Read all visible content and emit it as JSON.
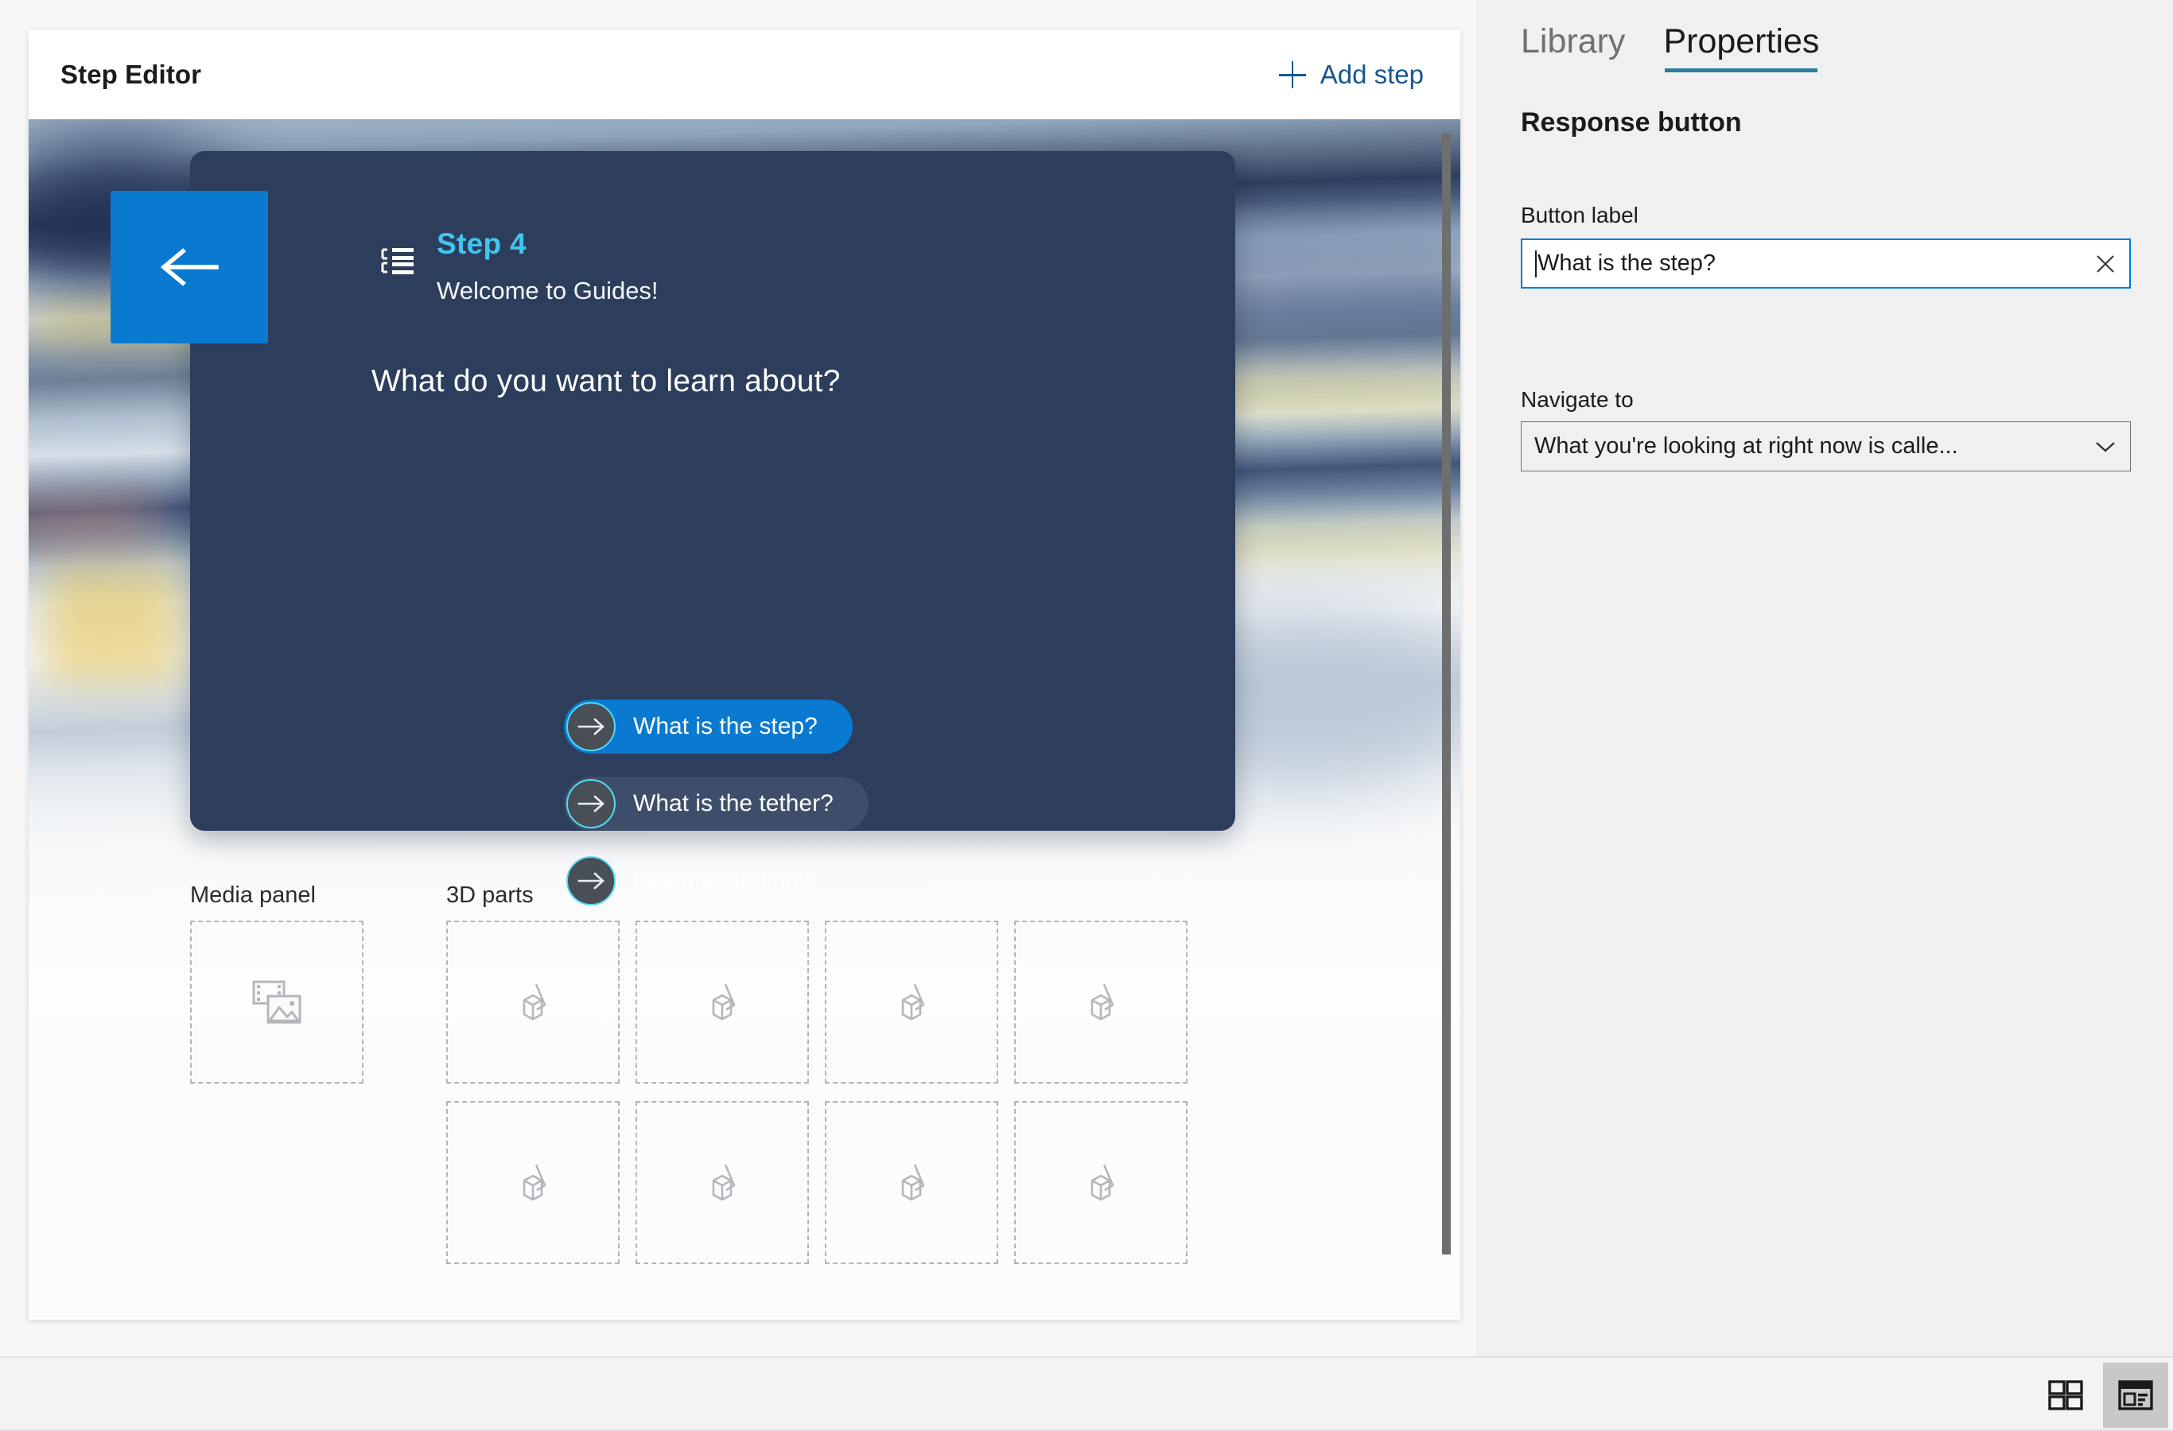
{
  "editor": {
    "title": "Step Editor",
    "add_step_label": "Add step",
    "add_step_icon": "plus-icon",
    "scrollbar": "vertical-scrollbar"
  },
  "hologram": {
    "back_button_icon": "arrow-left-icon",
    "list_icon": "list-icon",
    "step_label": "Step 4",
    "welcome_text": "Welcome to Guides!",
    "question": "What do you want to learn about?",
    "card_color": "#2c3e5c",
    "accent_color": "#0a7ad0",
    "step_label_color": "#41c6f0",
    "ring_color": "#52dcf5",
    "responses": [
      {
        "label": "What is the step?",
        "selected": true,
        "icon": "arrow-right-icon"
      },
      {
        "label": "What is the tether?",
        "selected": false,
        "icon": "arrow-right-icon"
      },
      {
        "label": "Features to know",
        "selected": false,
        "icon": "arrow-right-icon"
      }
    ]
  },
  "panels": {
    "media_label": "Media panel",
    "parts_label": "3D parts",
    "media_icon": "image-placeholder-icon",
    "part_icon": "3d-part-icon",
    "media_zone_count": 1,
    "parts_row1_count": 4,
    "parts_row2_count": 4
  },
  "properties": {
    "tabs": [
      {
        "label": "Library",
        "active": false
      },
      {
        "label": "Properties",
        "active": true
      }
    ],
    "title": "Response button",
    "button_label_field": {
      "label": "Button label",
      "value": "What is the step?",
      "placeholder": "Button label",
      "clear_icon": "close-icon",
      "focused": true,
      "focus_color": "#0078d4"
    },
    "navigate_field": {
      "label": "Navigate to",
      "value": "What you're looking at right now is calle...",
      "chevron_icon": "chevron-down-icon"
    },
    "tab_underline_color": "#2d7d9a"
  },
  "footer": {
    "view_buttons": [
      {
        "name": "grid-view",
        "icon": "grid-view-icon",
        "active": false
      },
      {
        "name": "detail-view",
        "icon": "detail-view-icon",
        "active": true
      }
    ]
  }
}
